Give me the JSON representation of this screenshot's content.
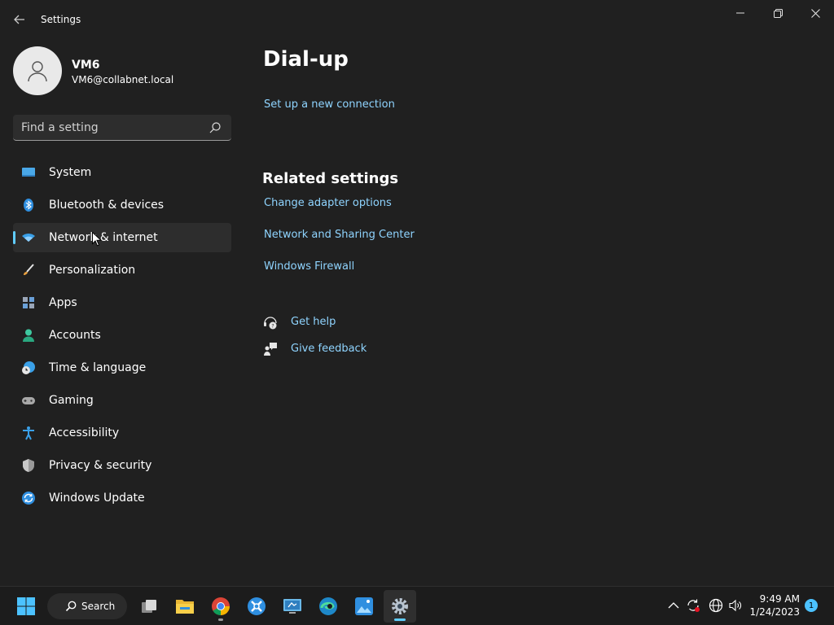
{
  "window": {
    "title": "Settings",
    "controls": {
      "minimize": "minimize-icon",
      "maximize": "restore-icon",
      "close": "close-icon"
    }
  },
  "profile": {
    "name": "VM6",
    "email": "VM6@collabnet.local"
  },
  "search": {
    "placeholder": "Find a setting"
  },
  "sidebar": {
    "items": [
      {
        "label": "System",
        "icon": "system-icon",
        "active": false
      },
      {
        "label": "Bluetooth & devices",
        "icon": "bluetooth-icon",
        "active": false
      },
      {
        "label": "Network & internet",
        "icon": "wifi-icon",
        "active": true
      },
      {
        "label": "Personalization",
        "icon": "brush-icon",
        "active": false
      },
      {
        "label": "Apps",
        "icon": "apps-icon",
        "active": false
      },
      {
        "label": "Accounts",
        "icon": "person-icon",
        "active": false
      },
      {
        "label": "Time & language",
        "icon": "clock-globe-icon",
        "active": false
      },
      {
        "label": "Gaming",
        "icon": "gamepad-icon",
        "active": false
      },
      {
        "label": "Accessibility",
        "icon": "accessibility-icon",
        "active": false
      },
      {
        "label": "Privacy & security",
        "icon": "shield-icon",
        "active": false
      },
      {
        "label": "Windows Update",
        "icon": "update-icon",
        "active": false
      }
    ]
  },
  "main": {
    "title": "Dial-up",
    "setup_link": "Set up a new connection",
    "related_title": "Related settings",
    "related_links": [
      "Change adapter options",
      "Network and Sharing Center",
      "Windows Firewall"
    ],
    "help": {
      "get_help": "Get help",
      "give_feedback": "Give feedback"
    }
  },
  "taskbar": {
    "search_label": "Search",
    "clock_time": "9:49 AM",
    "clock_date": "1/24/2023",
    "notification_count": "1"
  },
  "colors": {
    "accent": "#60cdff",
    "link": "#8fd4ff",
    "background": "#202020"
  }
}
